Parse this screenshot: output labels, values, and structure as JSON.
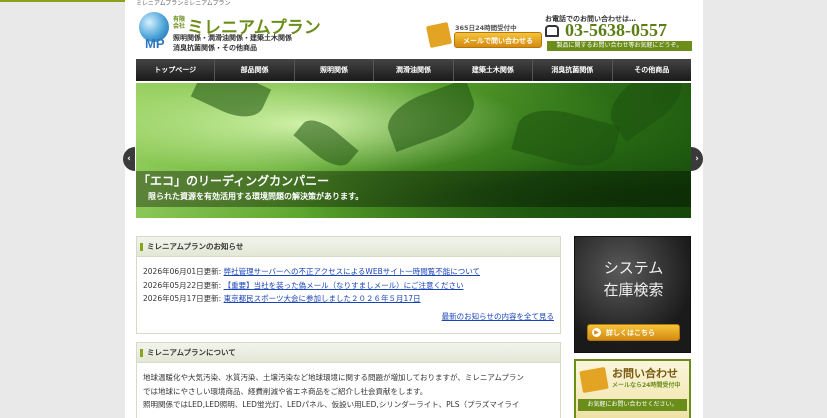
{
  "header": {
    "tagline": "ミレニアムプランミレニアムプラン",
    "logo_mark": "MP",
    "company_type": "有限会社",
    "company_name": "ミレニアムプラン",
    "business_line1": "照明関係・潤滑油関係・建築土木関係",
    "business_line2": "消臭抗菌関係・その他商品",
    "mail_note": "365日24時間受付中",
    "mail_button": "メールで問い合わせる",
    "tel_note": "お電話でのお問い合わせは…",
    "tel_number": "03-5638-0557",
    "tel_sub": "製品に関するお問い合わせ等お気軽にどうぞ。"
  },
  "nav": [
    "トップページ",
    "部品関係",
    "照明関係",
    "潤滑油関係",
    "建築土木関係",
    "消臭抗菌関係",
    "その他商品"
  ],
  "hero": {
    "title": "「エコ」のリーディングカンパニー",
    "subtitle": "限られた資源を有効活用する環境問題の解決策があります。",
    "prev_icon": "chevron-left-icon",
    "next_icon": "chevron-right-icon"
  },
  "news": {
    "heading": "ミレニアムプランのお知らせ",
    "items": [
      {
        "date": "2026年06月01日更新:",
        "text": "弊社管理サーバーへの不正アクセスによるWEBサイト一時閲覧不能について"
      },
      {
        "date": "2026年05月22日更新:",
        "text": "【重要】当社を装った偽メール（なりすましメール）にご注意ください"
      },
      {
        "date": "2026年05月17日更新:",
        "text": "東京都民スポーツ大会に参加しました２０２６年５月17日"
      }
    ],
    "more": "最新のお知らせの内容を全て見る"
  },
  "about": {
    "heading": "ミレニアムプランについて",
    "lines": [
      "地球温暖化や大気汚染、水質汚染、土壌汚染など地球環境に関する問題が増加しておりますが、ミレニアムプラン",
      "では地球にやさしい環境商品、経費削減や省エネ商品をご紹介し社会貢献をします。",
      "照明関係ではLED,LED照明、LED蛍光灯、LEDパネル、仮設い用LED,シリンダーライト、PLS（プラズマイライ"
    ]
  },
  "side": {
    "system_title_line1": "システム",
    "system_title_line2": "在庫検索",
    "system_button": "詳しくはこちら",
    "contact_title": "お問い合わせ",
    "contact_sub": "メールなら24時間受付中",
    "contact_bar": "お気軽にお問い合わせください。"
  },
  "colors": {
    "brand_green": "#6b8e1a",
    "accent_orange": "#e3a323",
    "link_blue": "#1a44b8"
  }
}
